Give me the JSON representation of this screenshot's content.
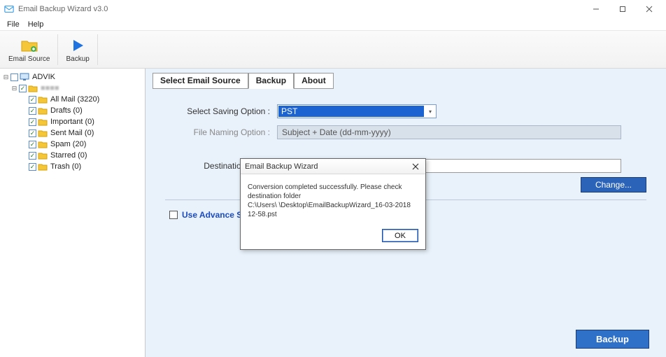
{
  "window": {
    "title": "Email Backup Wizard v3.0"
  },
  "menubar": {
    "file": "File",
    "help": "Help"
  },
  "toolbar": {
    "email_source_label": "Email Source",
    "backup_label": "Backup"
  },
  "tree": {
    "root": "ADVIK",
    "account_blur": "■■■■",
    "items": [
      {
        "label": "All Mail (3220)"
      },
      {
        "label": "Drafts (0)"
      },
      {
        "label": "Important (0)"
      },
      {
        "label": "Sent Mail (0)"
      },
      {
        "label": "Spam (20)"
      },
      {
        "label": "Starred (0)"
      },
      {
        "label": "Trash (0)"
      }
    ]
  },
  "tabs": {
    "select_source": "Select Email Source",
    "backup": "Backup",
    "about": "About"
  },
  "form": {
    "saving_option_label": "Select Saving Option  :",
    "saving_option_value": "PST",
    "naming_option_label": "File Naming Option  :",
    "naming_option_value": "Subject + Date (dd-mm-yyyy)",
    "dest_path_label": "Destination Path  :",
    "dest_path_value": "",
    "change_btn": "Change...",
    "advance_label": "Use Advance Settings for Selective Backup",
    "advance_label_visible": "Use Advance Sett",
    "backup_btn": "Backup"
  },
  "modal": {
    "title": "Email Backup Wizard",
    "line1": "Conversion completed successfully. Please check destination folder",
    "line2_prefix": "C:\\Users\\",
    "line2_blur": "   ",
    "line2_suffix": "\\Desktop\\EmailBackupWizard_16-03-2018 12-58.pst",
    "ok": "OK"
  }
}
